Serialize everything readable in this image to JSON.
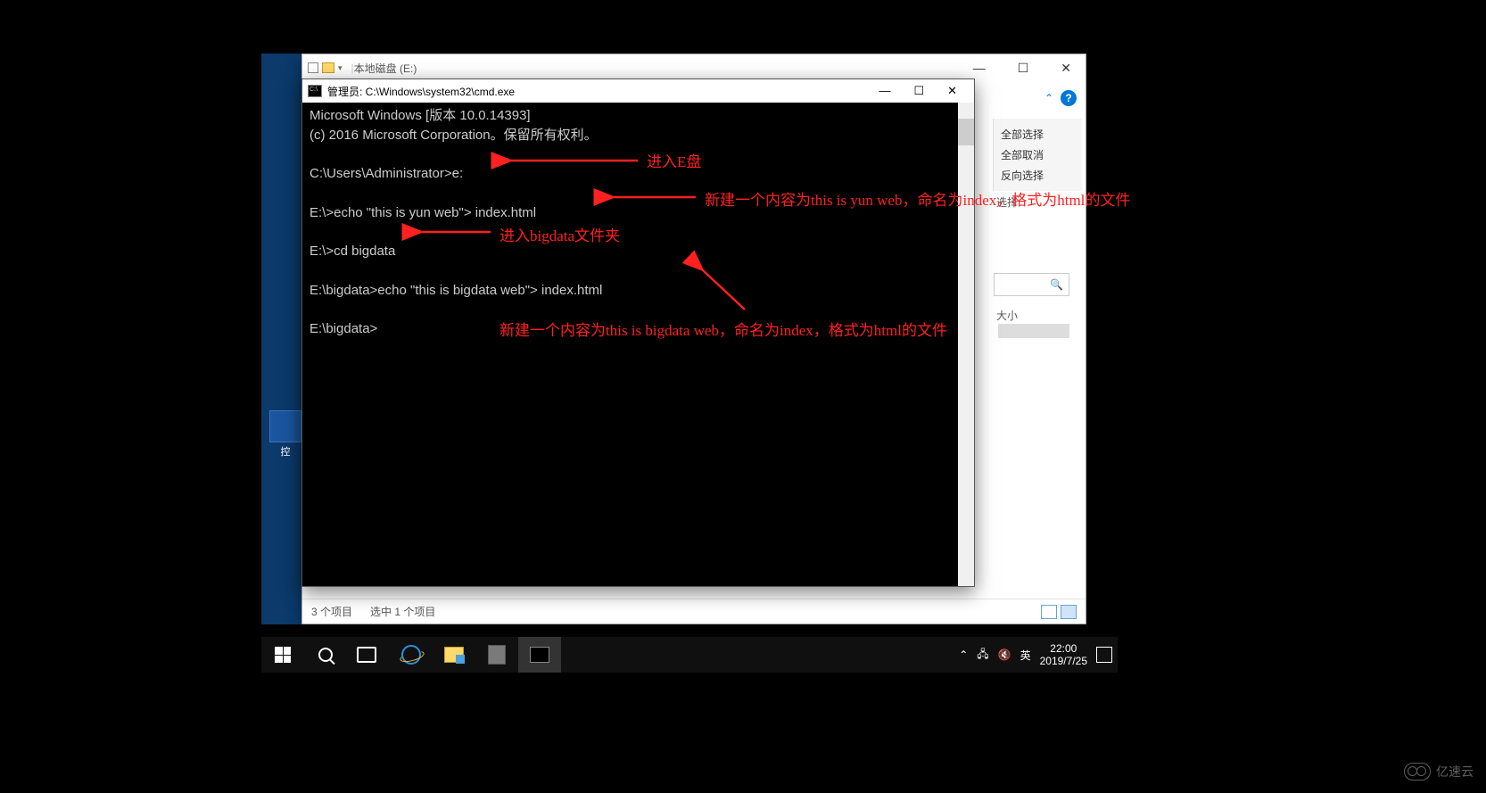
{
  "explorer": {
    "title": "本地磁盘 (E:)",
    "ribbon": {
      "select_all": "全部选择",
      "deselect_all": "全部取消",
      "invert": "反向选择",
      "category": "选择"
    },
    "column_size": "大小",
    "status_items": "3 个项目",
    "status_selected": "选中 1 个项目"
  },
  "cmd": {
    "title": "管理员: C:\\Windows\\system32\\cmd.exe",
    "lines": [
      "Microsoft Windows [版本 10.0.14393]",
      "(c) 2016 Microsoft Corporation。保留所有权利。",
      "",
      "C:\\Users\\Administrator>e:",
      "",
      "E:\\>echo \"this is yun web\"> index.html",
      "",
      "E:\\>cd bigdata",
      "",
      "E:\\bigdata>echo \"this is bigdata web\"> index.html",
      "",
      "E:\\bigdata>"
    ]
  },
  "annotations": {
    "a1": "进入E盘",
    "a2": "新建一个内容为this is yun web，命名为index，格式为html的文件",
    "a3": "进入bigdata文件夹",
    "a4": "新建一个内容为this is bigdata web，命名为index，格式为html的文件"
  },
  "desktop": {
    "label": "控"
  },
  "taskbar": {
    "ime": "英",
    "time": "22:00",
    "date": "2019/7/25",
    "tray_net": "⚠"
  },
  "watermark": "亿速云"
}
